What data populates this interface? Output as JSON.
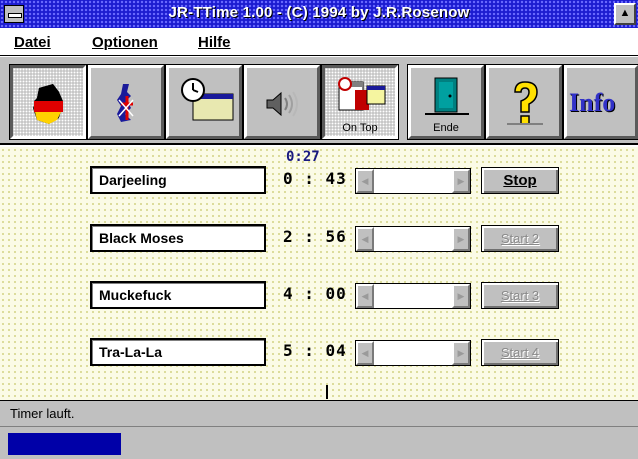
{
  "window": {
    "title": "JR-TTime 1.00 - (C) 1994 by J.R.Rosenow",
    "sysmenu_icon": "system-menu-icon",
    "maximize_icon": "maximize-icon"
  },
  "menu": {
    "items": [
      {
        "label": "Datei"
      },
      {
        "label": "Optionen"
      },
      {
        "label": "Hilfe"
      }
    ]
  },
  "toolbar": {
    "buttons": [
      {
        "icon": "germany-flag-icon",
        "label": ""
      },
      {
        "icon": "uk-flag-icon",
        "label": ""
      },
      {
        "icon": "clock-window-icon",
        "label": ""
      },
      {
        "icon": "speaker-icon",
        "label": ""
      },
      {
        "icon": "on-top-icon",
        "label": "On Top"
      },
      {
        "icon": "exit-door-icon",
        "label": "Ende"
      },
      {
        "icon": "help-question-icon",
        "label": ""
      },
      {
        "icon": "info-icon",
        "label": "Info"
      }
    ]
  },
  "main": {
    "elapsed": "0:27",
    "timers": [
      {
        "name": "Darjeeling",
        "time": "0 : 43",
        "button": "Stop",
        "active": true
      },
      {
        "name": "Black Moses",
        "time": "2 : 56",
        "button": "Start 2",
        "active": false
      },
      {
        "name": "Muckefuck",
        "time": "4 : 00",
        "button": "Start 3",
        "active": false
      },
      {
        "name": "Tra-La-La",
        "time": "5 : 04",
        "button": "Start 4",
        "active": false
      }
    ]
  },
  "status": {
    "text": "Timer lauft.",
    "progress": 0.18
  },
  "colors": {
    "titlebar": "#1c1cd0",
    "progress": "#0000a8",
    "panel": "#fbfbe6"
  }
}
